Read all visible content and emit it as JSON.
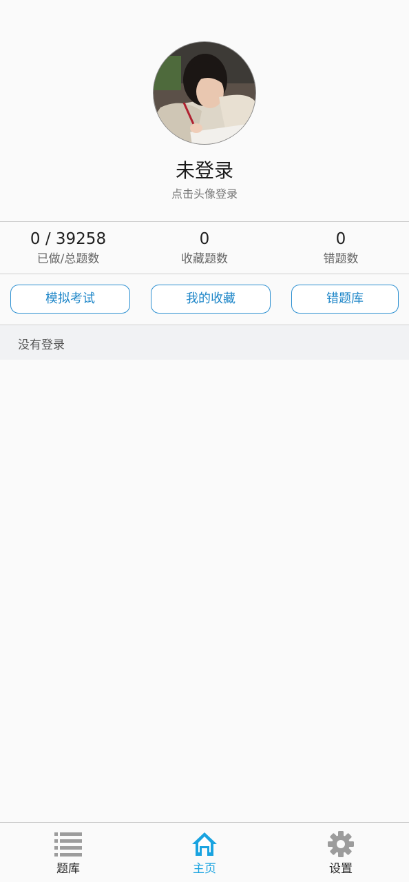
{
  "profile": {
    "username": "未登录",
    "login_hint": "点击头像登录"
  },
  "stats": [
    {
      "value": "0 / 39258",
      "label": "已做/总题数"
    },
    {
      "value": "0",
      "label": "收藏题数"
    },
    {
      "value": "0",
      "label": "错题数"
    }
  ],
  "actions": {
    "mock_exam": "模拟考试",
    "my_favorites": "我的收藏",
    "wrong_questions": "错题库"
  },
  "message": "没有登录",
  "tabs": [
    {
      "label": "题库",
      "icon": "list-icon",
      "active": false
    },
    {
      "label": "主页",
      "icon": "home-icon",
      "active": true
    },
    {
      "label": "设置",
      "icon": "gear-icon",
      "active": false
    }
  ],
  "colors": {
    "accent": "#19a3e0",
    "button_border": "#2b8fd1",
    "button_text": "#1e86c8",
    "icon_inactive": "#9c9c9c"
  }
}
